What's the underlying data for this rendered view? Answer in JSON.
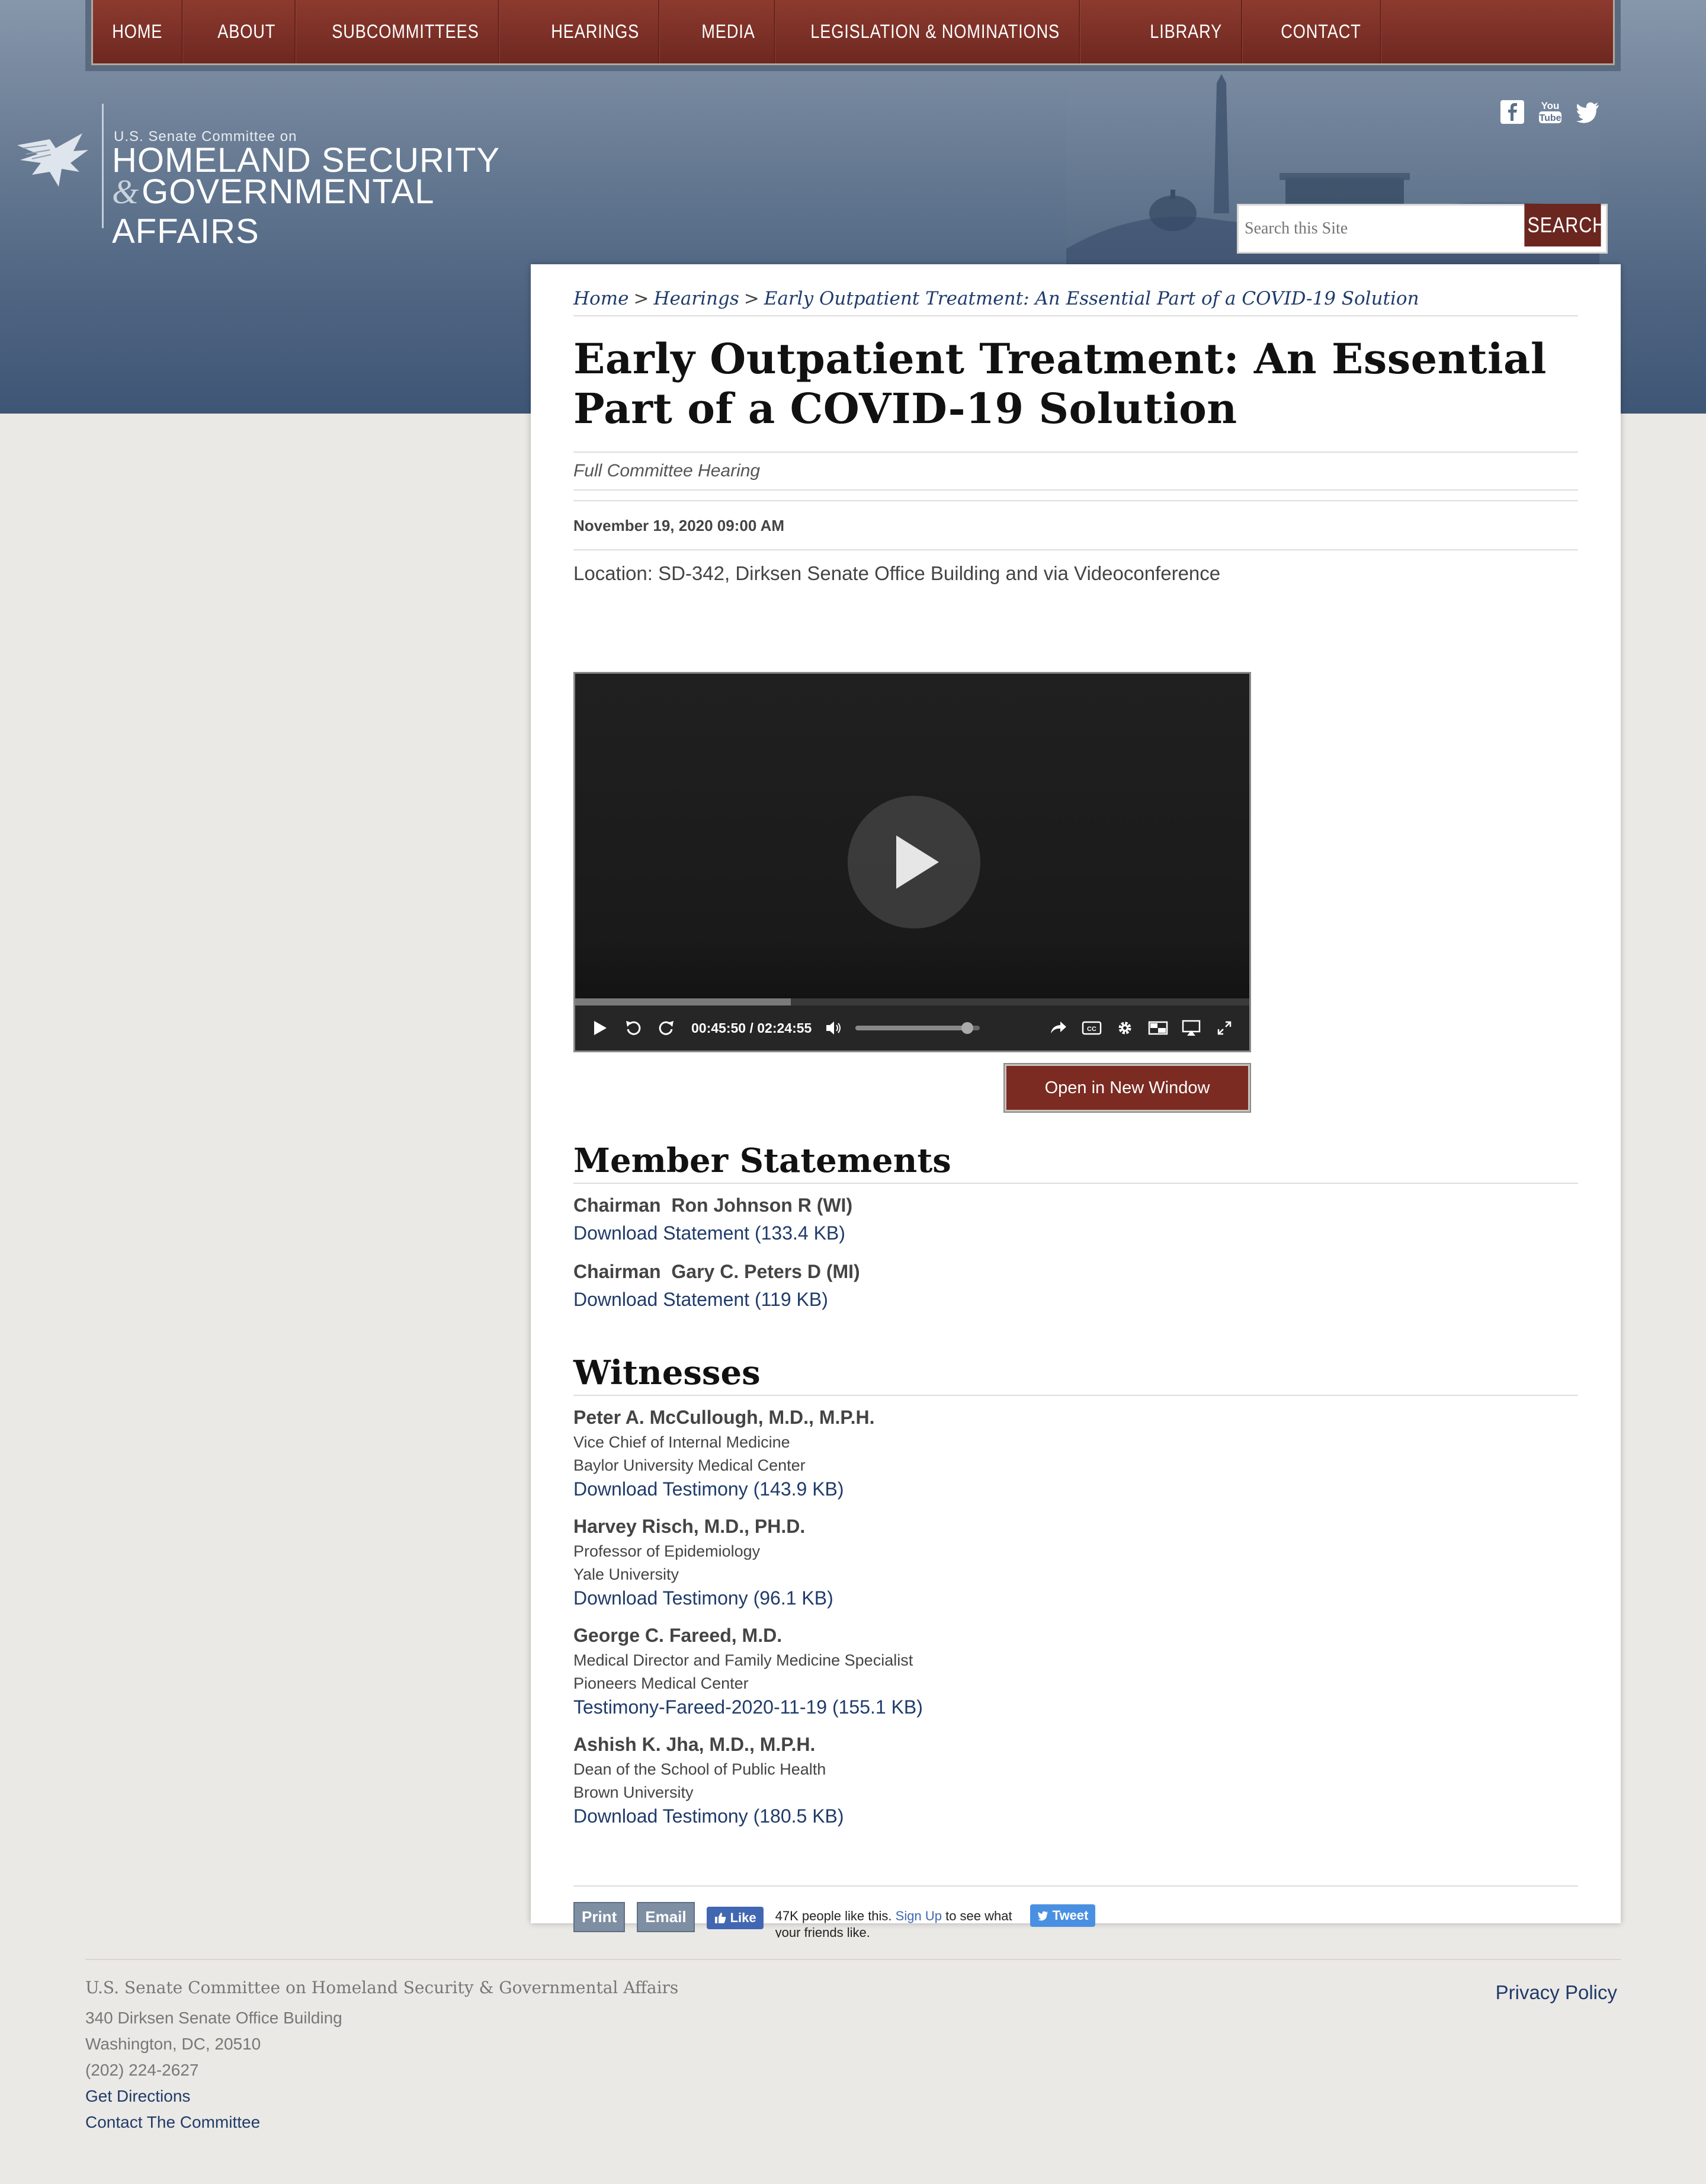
{
  "nav": {
    "items": [
      "HOME",
      "ABOUT",
      "SUBCOMMITTEES",
      "HEARINGS",
      "MEDIA",
      "LEGISLATION & NOMINATIONS",
      "LIBRARY",
      "CONTACT"
    ]
  },
  "logo": {
    "small": "U.S. Senate Committee on",
    "line1": "HOMELAND SECURITY",
    "amp": "&",
    "line2": "GOVERNMENTAL AFFAIRS"
  },
  "social": [
    "facebook-icon",
    "youtube-icon",
    "twitter-icon"
  ],
  "search": {
    "placeholder": "Search this Site",
    "button": "SEARCH"
  },
  "breadcrumb": {
    "home": "Home",
    "hearings": "Hearings",
    "current": "Early Outpatient Treatment: An Essential Part of a COVID-19 Solution",
    "separator": ">"
  },
  "hearing": {
    "title": "Early Outpatient Treatment: An Essential Part of a COVID-19 Solution",
    "type": "Full Committee Hearing",
    "date": "November 19, 2020 09:00 AM",
    "location": "Location: SD-342, Dirksen Senate Office Building and via Videoconference"
  },
  "video": {
    "current_time": "00:45:50",
    "time_separator": "/",
    "duration": "02:24:55",
    "progress": 0.32,
    "volume": 0.9,
    "open_button": "Open in New Window"
  },
  "member_statements": {
    "title": "Member Statements",
    "items": [
      {
        "name": "Chairman  Ron Johnson R (WI)",
        "link": "Download Statement (133.4 KB)"
      },
      {
        "name": "Chairman  Gary C. Peters D (MI)",
        "link": "Download Statement (119 KB)"
      }
    ]
  },
  "witnesses": {
    "title": "Witnesses",
    "items": [
      {
        "name": "Peter A. McCullough, M.D., M.P.H.",
        "role": "Vice Chief of Internal Medicine",
        "org": "Baylor University Medical Center",
        "link": "Download Testimony (143.9 KB)"
      },
      {
        "name": "Harvey Risch, M.D., PH.D.",
        "role": "Professor of Epidemiology",
        "org": "Yale University",
        "link": "Download Testimony (96.1 KB)"
      },
      {
        "name": "George C. Fareed, M.D.",
        "role": "Medical Director and Family Medicine Specialist",
        "org": "Pioneers Medical Center",
        "link": "Testimony-Fareed-2020-11-19 (155.1 KB)"
      },
      {
        "name": "Ashish K. Jha, M.D., M.P.H.",
        "role": "Dean of the School of Public Health",
        "org": "Brown University",
        "link": "Download Testimony (180.5 KB)"
      }
    ]
  },
  "share": {
    "print": "Print",
    "email": "Email",
    "like": "Like",
    "like_text_a": "47K people like this.",
    "signup": "Sign Up",
    "like_text_b": "to see what your friends like.",
    "tweet": "Tweet"
  },
  "footer": {
    "org": "U.S. Senate Committee on Homeland Security & Governmental Affairs",
    "address1": "340 Dirksen Senate Office Building",
    "address2": "Washington, DC, 20510",
    "phone": "(202) 224-2627",
    "directions": "Get Directions",
    "contact": "Contact The Committee",
    "privacy": "Privacy Policy"
  }
}
